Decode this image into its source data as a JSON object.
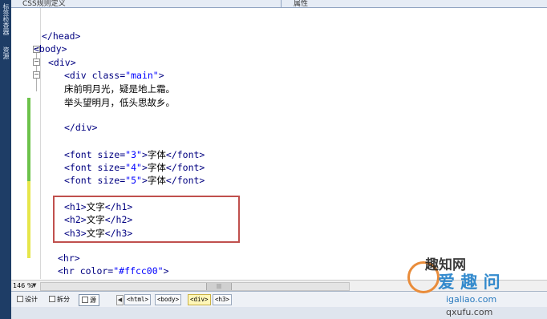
{
  "left_strip": {
    "label_top": "标签检查器",
    "label_mid": "资源"
  },
  "topbar": {
    "left_text": "CSS规则定义",
    "right_text": "属性"
  },
  "code_lines": [
    {
      "segments": [
        {
          "c": "t",
          "s": "</head>"
        }
      ]
    },
    {
      "segments": [
        {
          "c": "t",
          "s": "<body>"
        }
      ]
    },
    {
      "segments": [
        {
          "c": "t",
          "s": "<div>"
        }
      ]
    },
    {
      "segments": [
        {
          "c": "t",
          "s": "<div class="
        },
        {
          "c": "v",
          "s": "\"main\""
        },
        {
          "c": "t",
          "s": ">"
        }
      ]
    },
    {
      "segments": [
        {
          "c": "x",
          "s": "床前明月光，疑是地上霜。"
        }
      ]
    },
    {
      "segments": [
        {
          "c": "x",
          "s": "举头望明月，低头思故乡。"
        }
      ]
    },
    {
      "segments": [
        {
          "c": "x",
          "s": ""
        }
      ]
    },
    {
      "segments": [
        {
          "c": "t",
          "s": "</div>"
        }
      ]
    },
    {
      "segments": [
        {
          "c": "x",
          "s": ""
        }
      ]
    },
    {
      "segments": [
        {
          "c": "t",
          "s": "<font size="
        },
        {
          "c": "v",
          "s": "\"3\""
        },
        {
          "c": "t",
          "s": ">"
        },
        {
          "c": "x",
          "s": "字体"
        },
        {
          "c": "t",
          "s": "</font>"
        }
      ]
    },
    {
      "segments": [
        {
          "c": "t",
          "s": "<font size="
        },
        {
          "c": "v",
          "s": "\"4\""
        },
        {
          "c": "t",
          "s": ">"
        },
        {
          "c": "x",
          "s": "字体"
        },
        {
          "c": "t",
          "s": "</font>"
        }
      ]
    },
    {
      "segments": [
        {
          "c": "t",
          "s": "<font size="
        },
        {
          "c": "v",
          "s": "\"5\""
        },
        {
          "c": "t",
          "s": ">"
        },
        {
          "c": "x",
          "s": "字体"
        },
        {
          "c": "t",
          "s": "</font>"
        }
      ]
    },
    {
      "segments": [
        {
          "c": "x",
          "s": ""
        }
      ]
    },
    {
      "segments": [
        {
          "c": "t",
          "s": "<h1>"
        },
        {
          "c": "x",
          "s": "文字"
        },
        {
          "c": "t",
          "s": "</h1>"
        }
      ]
    },
    {
      "segments": [
        {
          "c": "t",
          "s": "<h2>"
        },
        {
          "c": "x",
          "s": "文字"
        },
        {
          "c": "t",
          "s": "</h2>"
        }
      ]
    },
    {
      "segments": [
        {
          "c": "t",
          "s": "<h3>"
        },
        {
          "c": "x",
          "s": "文字"
        },
        {
          "c": "t",
          "s": "</h3>"
        }
      ]
    },
    {
      "segments": [
        {
          "c": "x",
          "s": ""
        }
      ]
    },
    {
      "segments": [
        {
          "c": "t",
          "s": "<hr>"
        }
      ]
    },
    {
      "segments": [
        {
          "c": "t",
          "s": "<hr color="
        },
        {
          "c": "v",
          "s": "\"#ffcc00\""
        },
        {
          "c": "t",
          "s": ">"
        }
      ]
    }
  ],
  "zoom": {
    "value": "146 %"
  },
  "views": {
    "design": "设计",
    "split": "拆分",
    "code": "源"
  },
  "breadcrumb": [
    "<html>",
    "<body>",
    "<div>",
    "<h3>"
  ],
  "selected_tag": "<div>",
  "watermark": {
    "line1": "趣知网",
    "line2": "爱 趣 问",
    "line3": "igaliao.com",
    "line4": "qxufu.com"
  },
  "colors": {
    "tag": "#000080",
    "value": "#0000ff",
    "text": "#000000",
    "change_green": "#6cc24a",
    "change_yellow": "#e6e64a",
    "highlight_box": "#c0504d"
  }
}
